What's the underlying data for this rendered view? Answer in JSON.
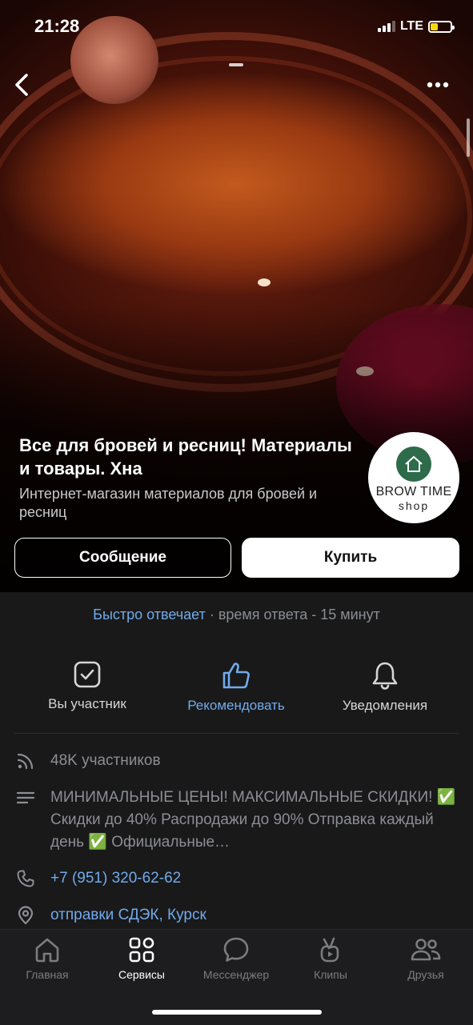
{
  "status": {
    "time": "21:28",
    "network": "LTE"
  },
  "header": {
    "title": "Все для бровей и ресниц! Материалы и товары. Хна",
    "subtitle": "Интернет-магазин материалов для бровей и ресниц",
    "logo_line1": "BROW TIME",
    "logo_line2": "shop"
  },
  "buttons": {
    "message": "Сообщение",
    "buy": "Купить"
  },
  "reply": {
    "fast": "Быстро отвечает",
    "time": " · время ответа - 15 минут"
  },
  "actions": [
    {
      "label": "Вы участник",
      "icon": "checkbox-icon"
    },
    {
      "label": "Рекомендовать",
      "icon": "thumbs-up-icon"
    },
    {
      "label": "Уведомления",
      "icon": "bell-icon"
    }
  ],
  "info": {
    "members": "48K участников",
    "description": "МИНИМАЛЬНЫЕ ЦЕНЫ! МАКСИМАЛЬНЫЕ СКИДКИ! ✅ Скидки до 40% Распродажи до 90% Отправка каждый день ✅ Официальные…",
    "phone": "+7 (951) 320-62-62",
    "address": "отправки СДЭК, Курск"
  },
  "tabs": [
    {
      "label": "Главная",
      "icon": "home-icon"
    },
    {
      "label": "Сервисы",
      "icon": "services-icon"
    },
    {
      "label": "Мессенджер",
      "icon": "chat-icon"
    },
    {
      "label": "Клипы",
      "icon": "clips-icon"
    },
    {
      "label": "Друзья",
      "icon": "friends-icon"
    }
  ],
  "colors": {
    "accent": "#71aaeb",
    "background": "#19191a",
    "logo_green": "#2d6b4a"
  }
}
